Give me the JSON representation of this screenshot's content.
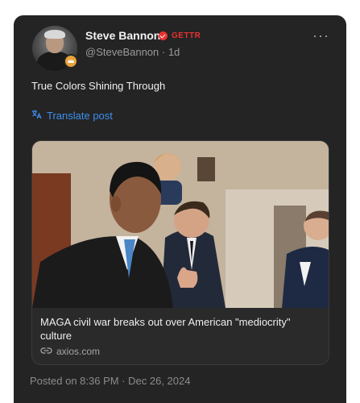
{
  "post": {
    "author_name": "Steve Bannon",
    "platform_tag": "GETTR",
    "handle_time": "@SteveBannon · 1d",
    "more_label": "···",
    "text": "True Colors Shining Through",
    "translate_label": "Translate post",
    "posted_on": "Posted on 8:36 PM · Dec 26, 2024"
  },
  "link_preview": {
    "title": "MAGA civil war breaks out over American \"mediocrity\" culture",
    "domain": "axios.com"
  },
  "colors": {
    "card_background": "#242424",
    "accent_link": "#3d8ff0",
    "platform_red": "#e8322e",
    "badge_gold": "#e8a23a"
  },
  "icons": {
    "verified": "verified-check-icon",
    "translate": "translate-icon",
    "more": "more-options-icon",
    "link": "link-icon",
    "badge": "member-badge-icon"
  }
}
